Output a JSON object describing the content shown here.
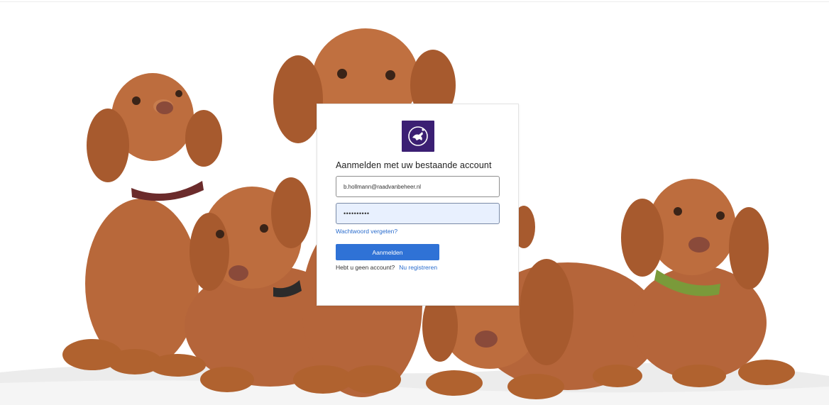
{
  "background": {
    "description_icon": "puppies-photo",
    "colors": {
      "fur": "#b8683a",
      "fur_dark": "#8e4a24",
      "blanket": "#eeeeee"
    }
  },
  "login": {
    "logo_icon": "dog-logo-icon",
    "logo_color": "#3b1f73",
    "heading": "Aanmelden met uw bestaande account",
    "email_value": "b.hollmann@raadvanbeheer.nl",
    "password_value": "••••••••••",
    "forgot_link": "Wachtwoord vergeten?",
    "submit_label": "Aanmelden",
    "no_account_text": "Hebt u geen account?",
    "register_link": "Nu registreren",
    "accent_color": "#2f72d6"
  }
}
